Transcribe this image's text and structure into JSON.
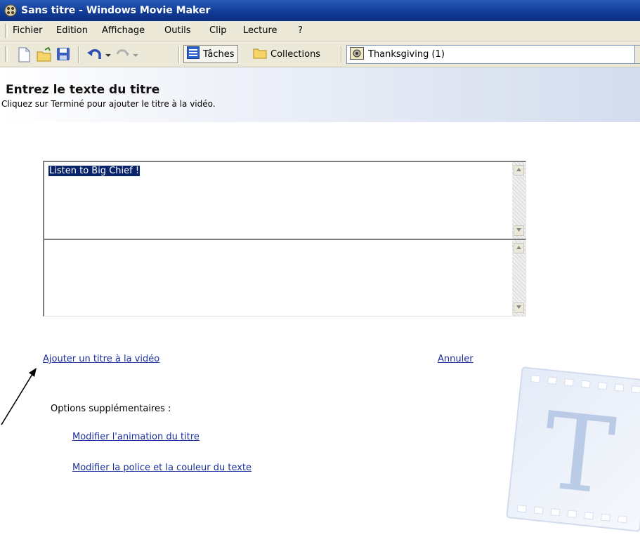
{
  "window": {
    "title": "Sans titre - Windows Movie Maker"
  },
  "menu": {
    "items": [
      "Fichier",
      "Edition",
      "Affichage",
      "Outils",
      "Clip",
      "Lecture",
      "?"
    ]
  },
  "toolbar": {
    "tasks_label": "Tâches",
    "collections_label": "Collections",
    "collection_value": "Thanksgiving (1)"
  },
  "header": {
    "title": "Entrez le texte du titre",
    "subtitle": "Cliquez sur Terminé pour ajouter le titre à la vidéo."
  },
  "editor": {
    "title_text": "Listen to Big Chief !",
    "subtitle_text": ""
  },
  "actions": {
    "add_title": "Ajouter un titre à la vidéo",
    "cancel": "Annuler"
  },
  "options": {
    "heading": "Options supplémentaires :",
    "change_animation": "Modifier l'animation du titre",
    "change_font": "Modifier la police et la couleur du texte"
  },
  "watermark": {
    "letter": "T"
  },
  "colors": {
    "titlebar": "#103a94",
    "link": "#1a2f9c",
    "selection": "#0a246a"
  }
}
